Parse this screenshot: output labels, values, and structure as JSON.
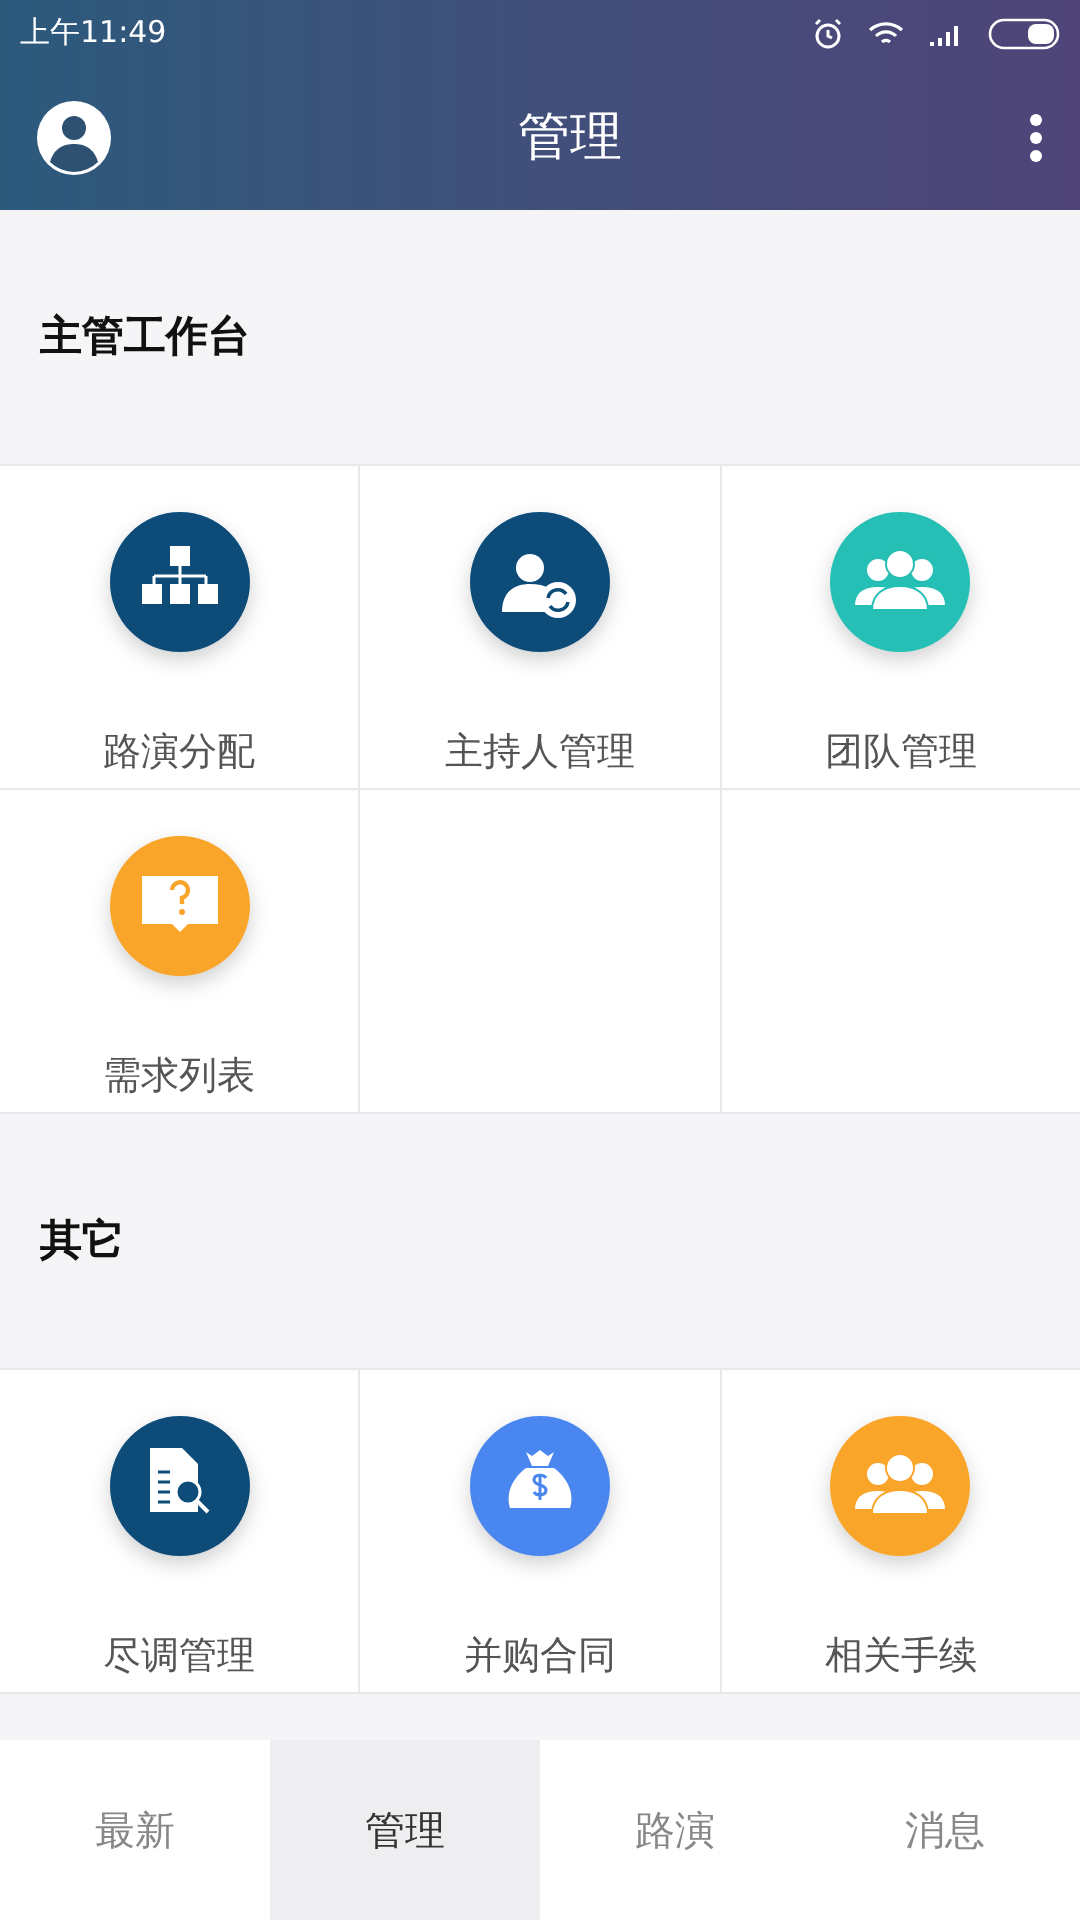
{
  "status_bar": {
    "time": "上午11:49"
  },
  "header": {
    "title": "管理"
  },
  "sections": [
    {
      "title": "主管工作台",
      "tiles": [
        {
          "label": "路演分配",
          "kind": "hierarchy",
          "color": "#0d4c78"
        },
        {
          "label": "主持人管理",
          "kind": "host",
          "color": "#0d4c78"
        },
        {
          "label": "团队管理",
          "kind": "team",
          "color": "#26bfb5"
        },
        {
          "label": "需求列表",
          "kind": "question",
          "color": "#f9a52a"
        }
      ]
    },
    {
      "title": "其它",
      "tiles": [
        {
          "label": "尽调管理",
          "kind": "doc-search",
          "color": "#0d4c78"
        },
        {
          "label": "并购合同",
          "kind": "money",
          "color": "#4a86f0"
        },
        {
          "label": "相关手续",
          "kind": "team",
          "color": "#f9a52a"
        }
      ]
    }
  ],
  "bottom_nav": [
    {
      "label": "最新",
      "selected": false
    },
    {
      "label": "管理",
      "selected": true
    },
    {
      "label": "路演",
      "selected": false
    },
    {
      "label": "消息",
      "selected": false
    }
  ]
}
